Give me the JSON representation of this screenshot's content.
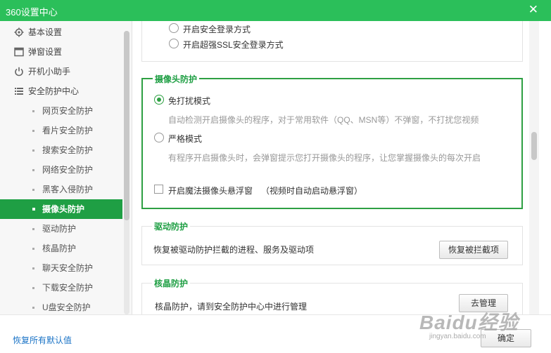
{
  "window": {
    "title": "360设置中心",
    "close_glyph": "✕"
  },
  "sidebar": {
    "items": [
      {
        "label": "基本设置",
        "icon": "gear-icon"
      },
      {
        "label": "弹窗设置",
        "icon": "window-icon"
      },
      {
        "label": "开机小助手",
        "icon": "power-icon"
      },
      {
        "label": "安全防护中心",
        "icon": "list-icon"
      }
    ],
    "sub_items": [
      "网页安全防护",
      "看片安全防护",
      "搜索安全防护",
      "网络安全防护",
      "黑客入侵防护",
      "摄像头防护",
      "驱动防护",
      "核晶防护",
      "聊天安全防护",
      "下载安全防护",
      "U盘安全防护"
    ],
    "active": "摄像头防护"
  },
  "login": {
    "option1": "开启安全登录方式",
    "option2": "开启超强SSL安全登录方式"
  },
  "camera": {
    "title": "摄像头防护",
    "mode1_label": "免打扰模式",
    "mode1_desc": "自动检测开启摄像头的程序，对于常用软件（QQ、MSN等）不弹窗，不打扰您视频",
    "mode2_label": "严格模式",
    "mode2_desc": "有程序开启摄像头时，会弹窗提示您打开摄像头的程序，让您掌握摄像头的每次开启",
    "float_label": "开启魔法摄像头悬浮窗",
    "float_note": "（视频时自动启动悬浮窗）",
    "selected": "免打扰模式"
  },
  "driver": {
    "title": "驱动防护",
    "text": "恢复被驱动防护拦截的进程、服务及驱动项",
    "button": "恢复被拦截项"
  },
  "kernel": {
    "title": "核晶防护",
    "text": "核晶防护，请到安全防护中心中进行管理",
    "button": "去管理"
  },
  "footer": {
    "restore_link": "恢复所有默认值",
    "ok_button": "确定"
  },
  "watermark": {
    "big": "Baidu经验",
    "small": "jingyan.baidu.com"
  },
  "colors": {
    "accent": "#2bbf5a",
    "active": "#1f9f44",
    "link": "#1a73c6"
  }
}
